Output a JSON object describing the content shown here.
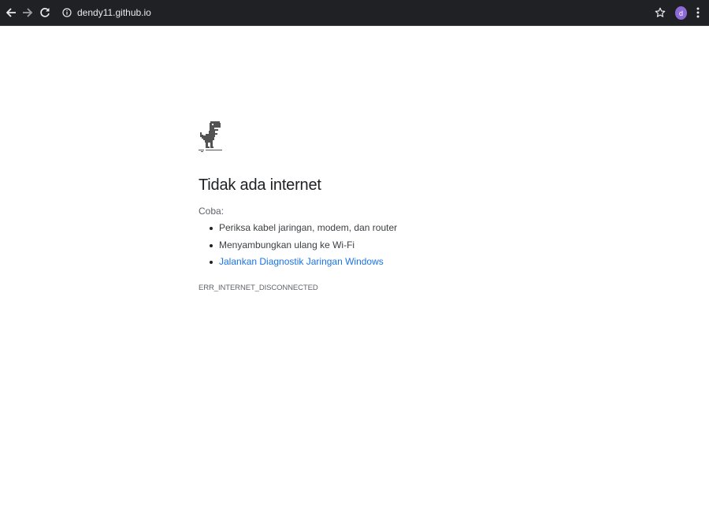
{
  "toolbar": {
    "url": "dendy11.github.io",
    "avatar_initial": "d",
    "icons": {
      "back": "arrow-left-icon",
      "forward": "arrow-right-icon",
      "reload": "reload-icon",
      "site_info": "info-icon",
      "bookmark": "star-icon",
      "menu": "kebab-menu-icon"
    },
    "colors": {
      "background": "#202124",
      "avatar": "#8e6ad6"
    }
  },
  "error_page": {
    "icon": "offline-dino-icon",
    "title": "Tidak ada internet",
    "try_label": "Coba:",
    "suggestions": [
      "Periksa kabel jaringan, modem, dan router",
      "Menyambungkan ulang ke Wi-Fi"
    ],
    "diagnostic_link": "Jalankan Diagnostik Jaringan Windows",
    "error_code": "ERR_INTERNET_DISCONNECTED",
    "link_color": "#1a73e8"
  }
}
